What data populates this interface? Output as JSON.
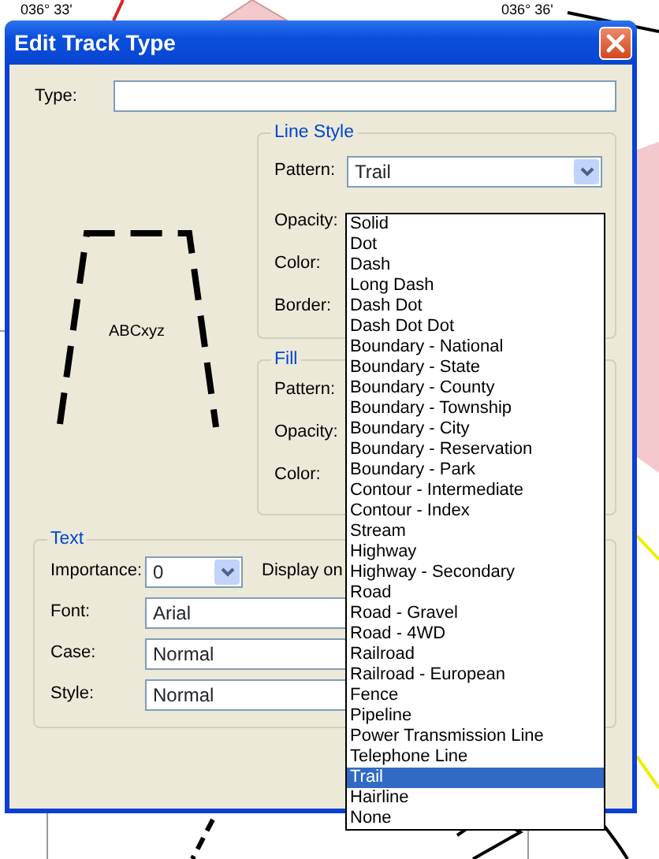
{
  "map": {
    "labels": [
      "036° 33'",
      "036° 36'"
    ]
  },
  "window": {
    "title": "Edit Track Type"
  },
  "type_field": {
    "label": "Type:"
  },
  "preview": {
    "sample_text": "ABCxyz"
  },
  "line_style": {
    "title": "Line Style",
    "fields": [
      {
        "label": "Pattern:",
        "value": "Trail"
      },
      {
        "label": "Opacity:"
      },
      {
        "label": "Color:"
      },
      {
        "label": "Border:"
      }
    ]
  },
  "fill": {
    "title": "Fill",
    "fields": [
      {
        "label": "Pattern:"
      },
      {
        "label": "Opacity:"
      },
      {
        "label": "Color:"
      }
    ]
  },
  "text": {
    "title": "Text",
    "importance": {
      "label": "Importance:",
      "value": "0"
    },
    "display_label": "Display on",
    "fields": [
      {
        "label": "Font:",
        "value": "Arial"
      },
      {
        "label": "Case:",
        "value": "Normal"
      },
      {
        "label": "Style:",
        "value": "Normal"
      }
    ]
  },
  "pattern_list": {
    "options": [
      {
        "label": "Solid",
        "selected": false
      },
      {
        "label": "Dot",
        "selected": false
      },
      {
        "label": "Dash",
        "selected": false
      },
      {
        "label": "Long Dash",
        "selected": false
      },
      {
        "label": "Dash Dot",
        "selected": false
      },
      {
        "label": "Dash Dot Dot",
        "selected": false
      },
      {
        "label": "Boundary - National",
        "selected": false
      },
      {
        "label": "Boundary - State",
        "selected": false
      },
      {
        "label": "Boundary - County",
        "selected": false
      },
      {
        "label": "Boundary - Township",
        "selected": false
      },
      {
        "label": "Boundary - City",
        "selected": false
      },
      {
        "label": "Boundary - Reservation",
        "selected": false
      },
      {
        "label": "Boundary - Park",
        "selected": false
      },
      {
        "label": "Contour - Intermediate",
        "selected": false
      },
      {
        "label": "Contour - Index",
        "selected": false
      },
      {
        "label": "Stream",
        "selected": false
      },
      {
        "label": "Highway",
        "selected": false
      },
      {
        "label": "Highway - Secondary",
        "selected": false
      },
      {
        "label": "Road",
        "selected": false
      },
      {
        "label": "Road - Gravel",
        "selected": false
      },
      {
        "label": "Road - 4WD",
        "selected": false
      },
      {
        "label": "Railroad",
        "selected": false
      },
      {
        "label": "Railroad - European",
        "selected": false
      },
      {
        "label": "Fence",
        "selected": false
      },
      {
        "label": "Pipeline",
        "selected": false
      },
      {
        "label": "Power Transmission Line",
        "selected": false
      },
      {
        "label": "Telephone Line",
        "selected": false
      },
      {
        "label": "Trail",
        "selected": true
      },
      {
        "label": "Hairline",
        "selected": false
      },
      {
        "label": "None",
        "selected": false
      }
    ]
  }
}
